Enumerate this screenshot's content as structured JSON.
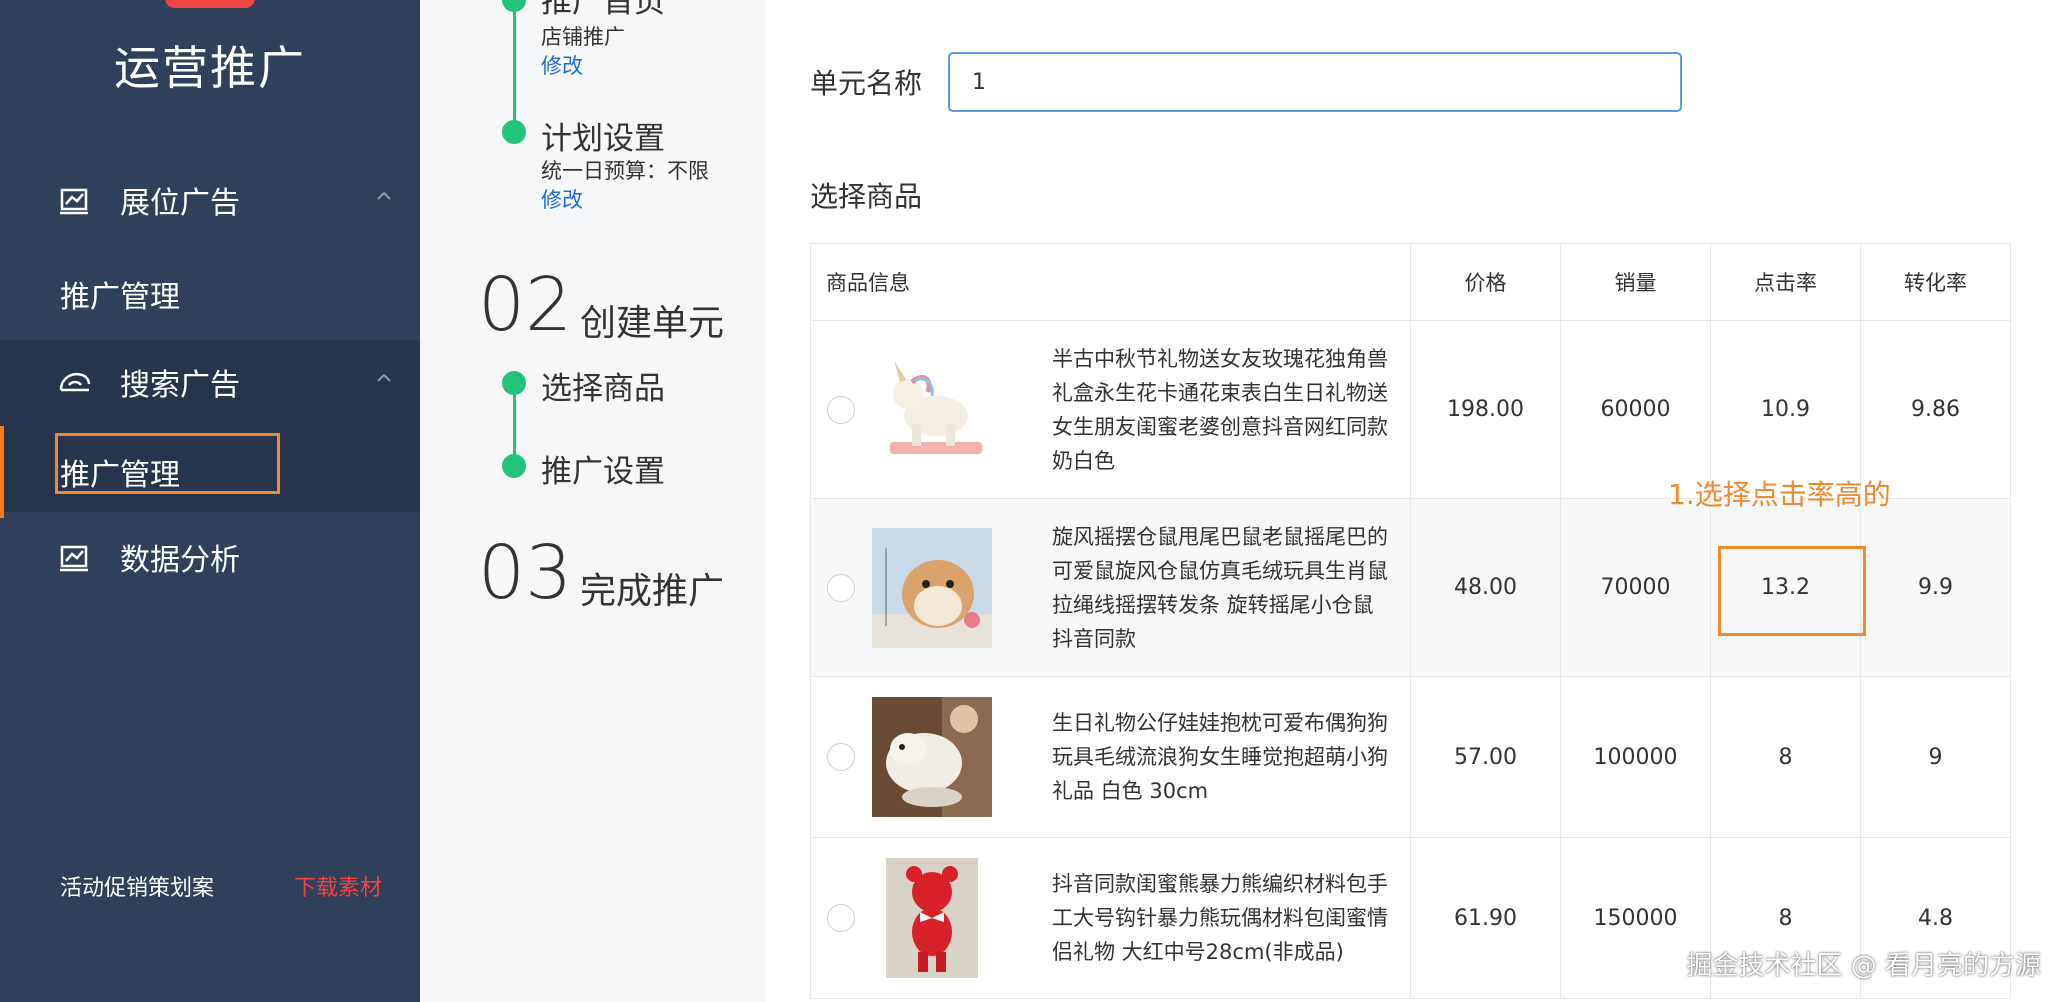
{
  "sidebar": {
    "title": "运营推广",
    "groups": [
      {
        "label": "展位广告",
        "icon": "display-ad-icon"
      },
      {
        "label": "搜索广告",
        "icon": "search-ad-icon"
      }
    ],
    "items": {
      "display_manage": "推广管理",
      "search_manage": "推广管理",
      "data_analysis": "数据分析"
    },
    "footer": {
      "promo": "活动促销策划案",
      "download": "下载素材"
    }
  },
  "steps": {
    "step1_title": "推广首页",
    "step1_sub": "店铺推广",
    "step1_edit": "修改",
    "plan_title": "计划设置",
    "plan_sub": "统一日预算：不限",
    "plan_edit": "修改",
    "phase2_num": "02",
    "phase2_label": "创建单元",
    "sub_select": "选择商品",
    "sub_setting": "推广设置",
    "phase3_num": "03",
    "phase3_label": "完成推广"
  },
  "form": {
    "unit_name_label": "单元名称",
    "unit_name_value": "1",
    "select_title": "选择商品"
  },
  "table": {
    "headers": [
      "商品信息",
      "价格",
      "销量",
      "点击率",
      "转化率"
    ],
    "rows": [
      {
        "name": "半古中秋节礼物送女友玫瑰花独角兽礼盒永生花卡通花束表白生日礼物送女生朋友闺蜜老婆创意抖音网红同款奶白色",
        "price": "198.00",
        "sales": "60000",
        "ctr": "10.9",
        "cvr": "9.86"
      },
      {
        "name": "旋风摇摆仓鼠甩尾巴鼠老鼠摇尾巴的可爱鼠旋风仓鼠仿真毛绒玩具生肖鼠拉绳线摇摆转发条 旋转摇尾小仓鼠抖音同款",
        "price": "48.00",
        "sales": "70000",
        "ctr": "13.2",
        "cvr": "9.9"
      },
      {
        "name": "生日礼物公仔娃娃抱枕可爱布偶狗狗玩具毛绒流浪狗女生睡觉抱超萌小狗礼品 白色 30cm",
        "price": "57.00",
        "sales": "100000",
        "ctr": "8",
        "cvr": "9"
      },
      {
        "name": "抖音同款闺蜜熊暴力熊编织材料包手工大号钩针暴力熊玩偶材料包闺蜜情侣礼物 大红中号28cm(非成品)",
        "price": "61.90",
        "sales": "150000",
        "ctr": "8",
        "cvr": "4.8"
      }
    ]
  },
  "annotation": "1.选择点击率高的",
  "watermark": "掘金技术社区 @ 看月亮的方源",
  "colors": {
    "sidebar": "#2f3f5c",
    "accent": "#22c47a",
    "highlight": "#f08a2c",
    "link": "#1a6bd6",
    "danger": "#f0453e"
  }
}
